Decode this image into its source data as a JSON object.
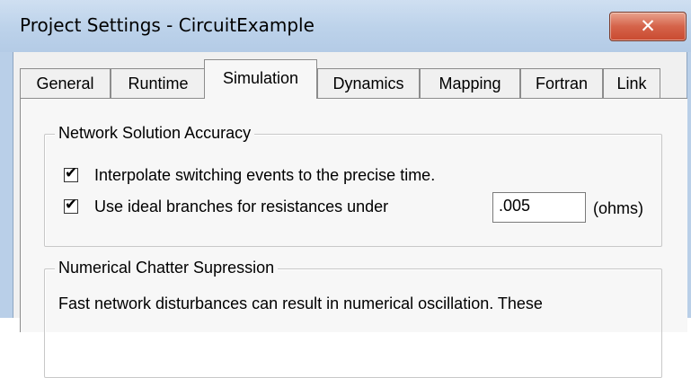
{
  "window": {
    "title": "Project Settings - CircuitExample",
    "close_glyph": "✕"
  },
  "tabs": [
    {
      "label": "General",
      "active": false
    },
    {
      "label": "Runtime",
      "active": false
    },
    {
      "label": "Simulation",
      "active": true
    },
    {
      "label": "Dynamics",
      "active": false
    },
    {
      "label": "Mapping",
      "active": false
    },
    {
      "label": "Fortran",
      "active": false
    },
    {
      "label": "Link",
      "active": false
    }
  ],
  "accuracy_group": {
    "title": "Network Solution Accuracy",
    "interpolate": {
      "label": "Interpolate switching events to the precise time.",
      "checked": true
    },
    "ideal_branches": {
      "label": "Use ideal branches for resistances under",
      "checked": true
    },
    "resistance_value": ".005",
    "unit_label": "(ohms)"
  },
  "chatter_group": {
    "title": "Numerical Chatter Supression",
    "description": "Fast network disturbances can result in numerical oscillation. These"
  },
  "colors": {
    "titlebar": "#bcd2ea",
    "close_button": "#c94a30",
    "dialog_background": "#f0f0f0"
  }
}
